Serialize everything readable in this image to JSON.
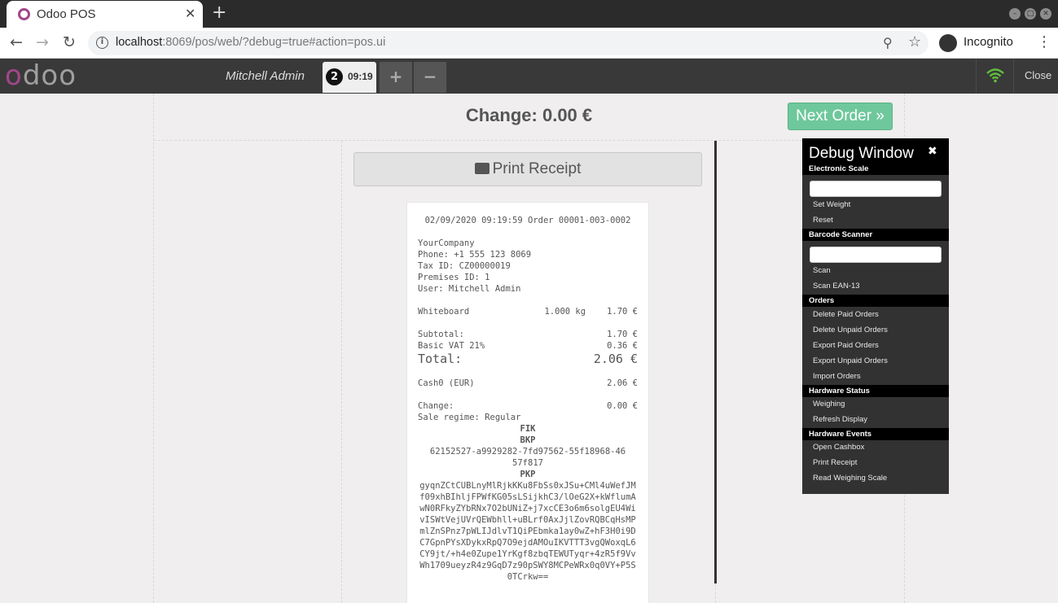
{
  "browser": {
    "tab_title": "Odoo POS",
    "url_host": "localhost",
    "url_rest": ":8069/pos/web/?debug=true#action=pos.ui",
    "profile_label": "Incognito"
  },
  "header": {
    "logo": "odoo",
    "user": "Mitchell Admin",
    "order_number": "2",
    "order_time": "09:19",
    "add_label": "+",
    "remove_label": "−",
    "close_label": "Close"
  },
  "screen": {
    "change_title": "Change: 0.00 €",
    "next_order": "Next Order »",
    "print_receipt": "Print Receipt"
  },
  "receipt": {
    "header_line": "02/09/2020 09:19:59 Order 00001-003-0002",
    "company": "YourCompany",
    "phone": "Phone: +1 555 123 8069",
    "tax_id": "Tax ID: CZ00000019",
    "premises": "Premises ID: 1",
    "user": "User: Mitchell Admin",
    "line": {
      "product": "Whiteboard",
      "qty": "1.000 kg",
      "price": "1.70 €"
    },
    "subtotal": {
      "label": "Subtotal:",
      "value": "1.70 €"
    },
    "vat": {
      "label": "Basic VAT 21%",
      "value": "0.36 €"
    },
    "total": {
      "label": "Total:",
      "value": "2.06 €"
    },
    "payment": {
      "label": "Cash0 (EUR)",
      "value": "2.06 €"
    },
    "change": {
      "label": "Change:",
      "value": "0.00 €"
    },
    "regime": "Sale regime: Regular",
    "fik_label": "FIK",
    "bkp_label": "BKP",
    "bkp_value": "62152527-a9929282-7fd97562-55f18968-4657f817",
    "pkp_label": "PKP",
    "pkp_value": "gyqnZCtCUBLnyMlRjkKKu8FbSs0xJSu+CMl4uWefJMf09xhBIhljFPWfKG05sLSijkhC3/lOeG2X+kWflumAwN0RFkyZYbRNx7O2bUNiZ+j7xcCE3o6m6solgEU4WivISWtVejUVrQEWbhll+uBLrf0AxJjlZovRQBCqHsMPmlZnSPnz7pWLIJdlvT1QiPEbmka1ay0wZ+hF3H0i9DC7GpnPYsXDykxRpQ7O9ejdAMOuIKVTTT3vgQWoxqL6CY9jt/+h4e0Zupe1YrKgf8zbqTEWUTyqr+4zR5f9VvWh1709ueyzR4z9GqD7z90pSWY8MCPeWRx0q0VY+P5S0TCrkw=="
  },
  "debug": {
    "title": "Debug Window",
    "close": "✖",
    "sections": {
      "scale": "Electronic Scale",
      "barcode": "Barcode Scanner",
      "orders": "Orders",
      "hw_status": "Hardware Status",
      "hw_events": "Hardware Events"
    },
    "items": {
      "set_weight": "Set Weight",
      "reset": "Reset",
      "scan": "Scan",
      "scan_ean": "Scan EAN-13",
      "delete_paid": "Delete Paid Orders",
      "delete_unpaid": "Delete Unpaid Orders",
      "export_paid": "Export Paid Orders",
      "export_unpaid": "Export Unpaid Orders",
      "import": "Import Orders",
      "weighing": "Weighing",
      "refresh": "Refresh Display",
      "open_cashbox": "Open Cashbox",
      "print_receipt": "Print Receipt",
      "read_scale": "Read Weighing Scale"
    }
  },
  "colors": {
    "odoo_purple": "#a24689",
    "next_order_green": "#6ec89b",
    "header_dark": "#393939"
  }
}
